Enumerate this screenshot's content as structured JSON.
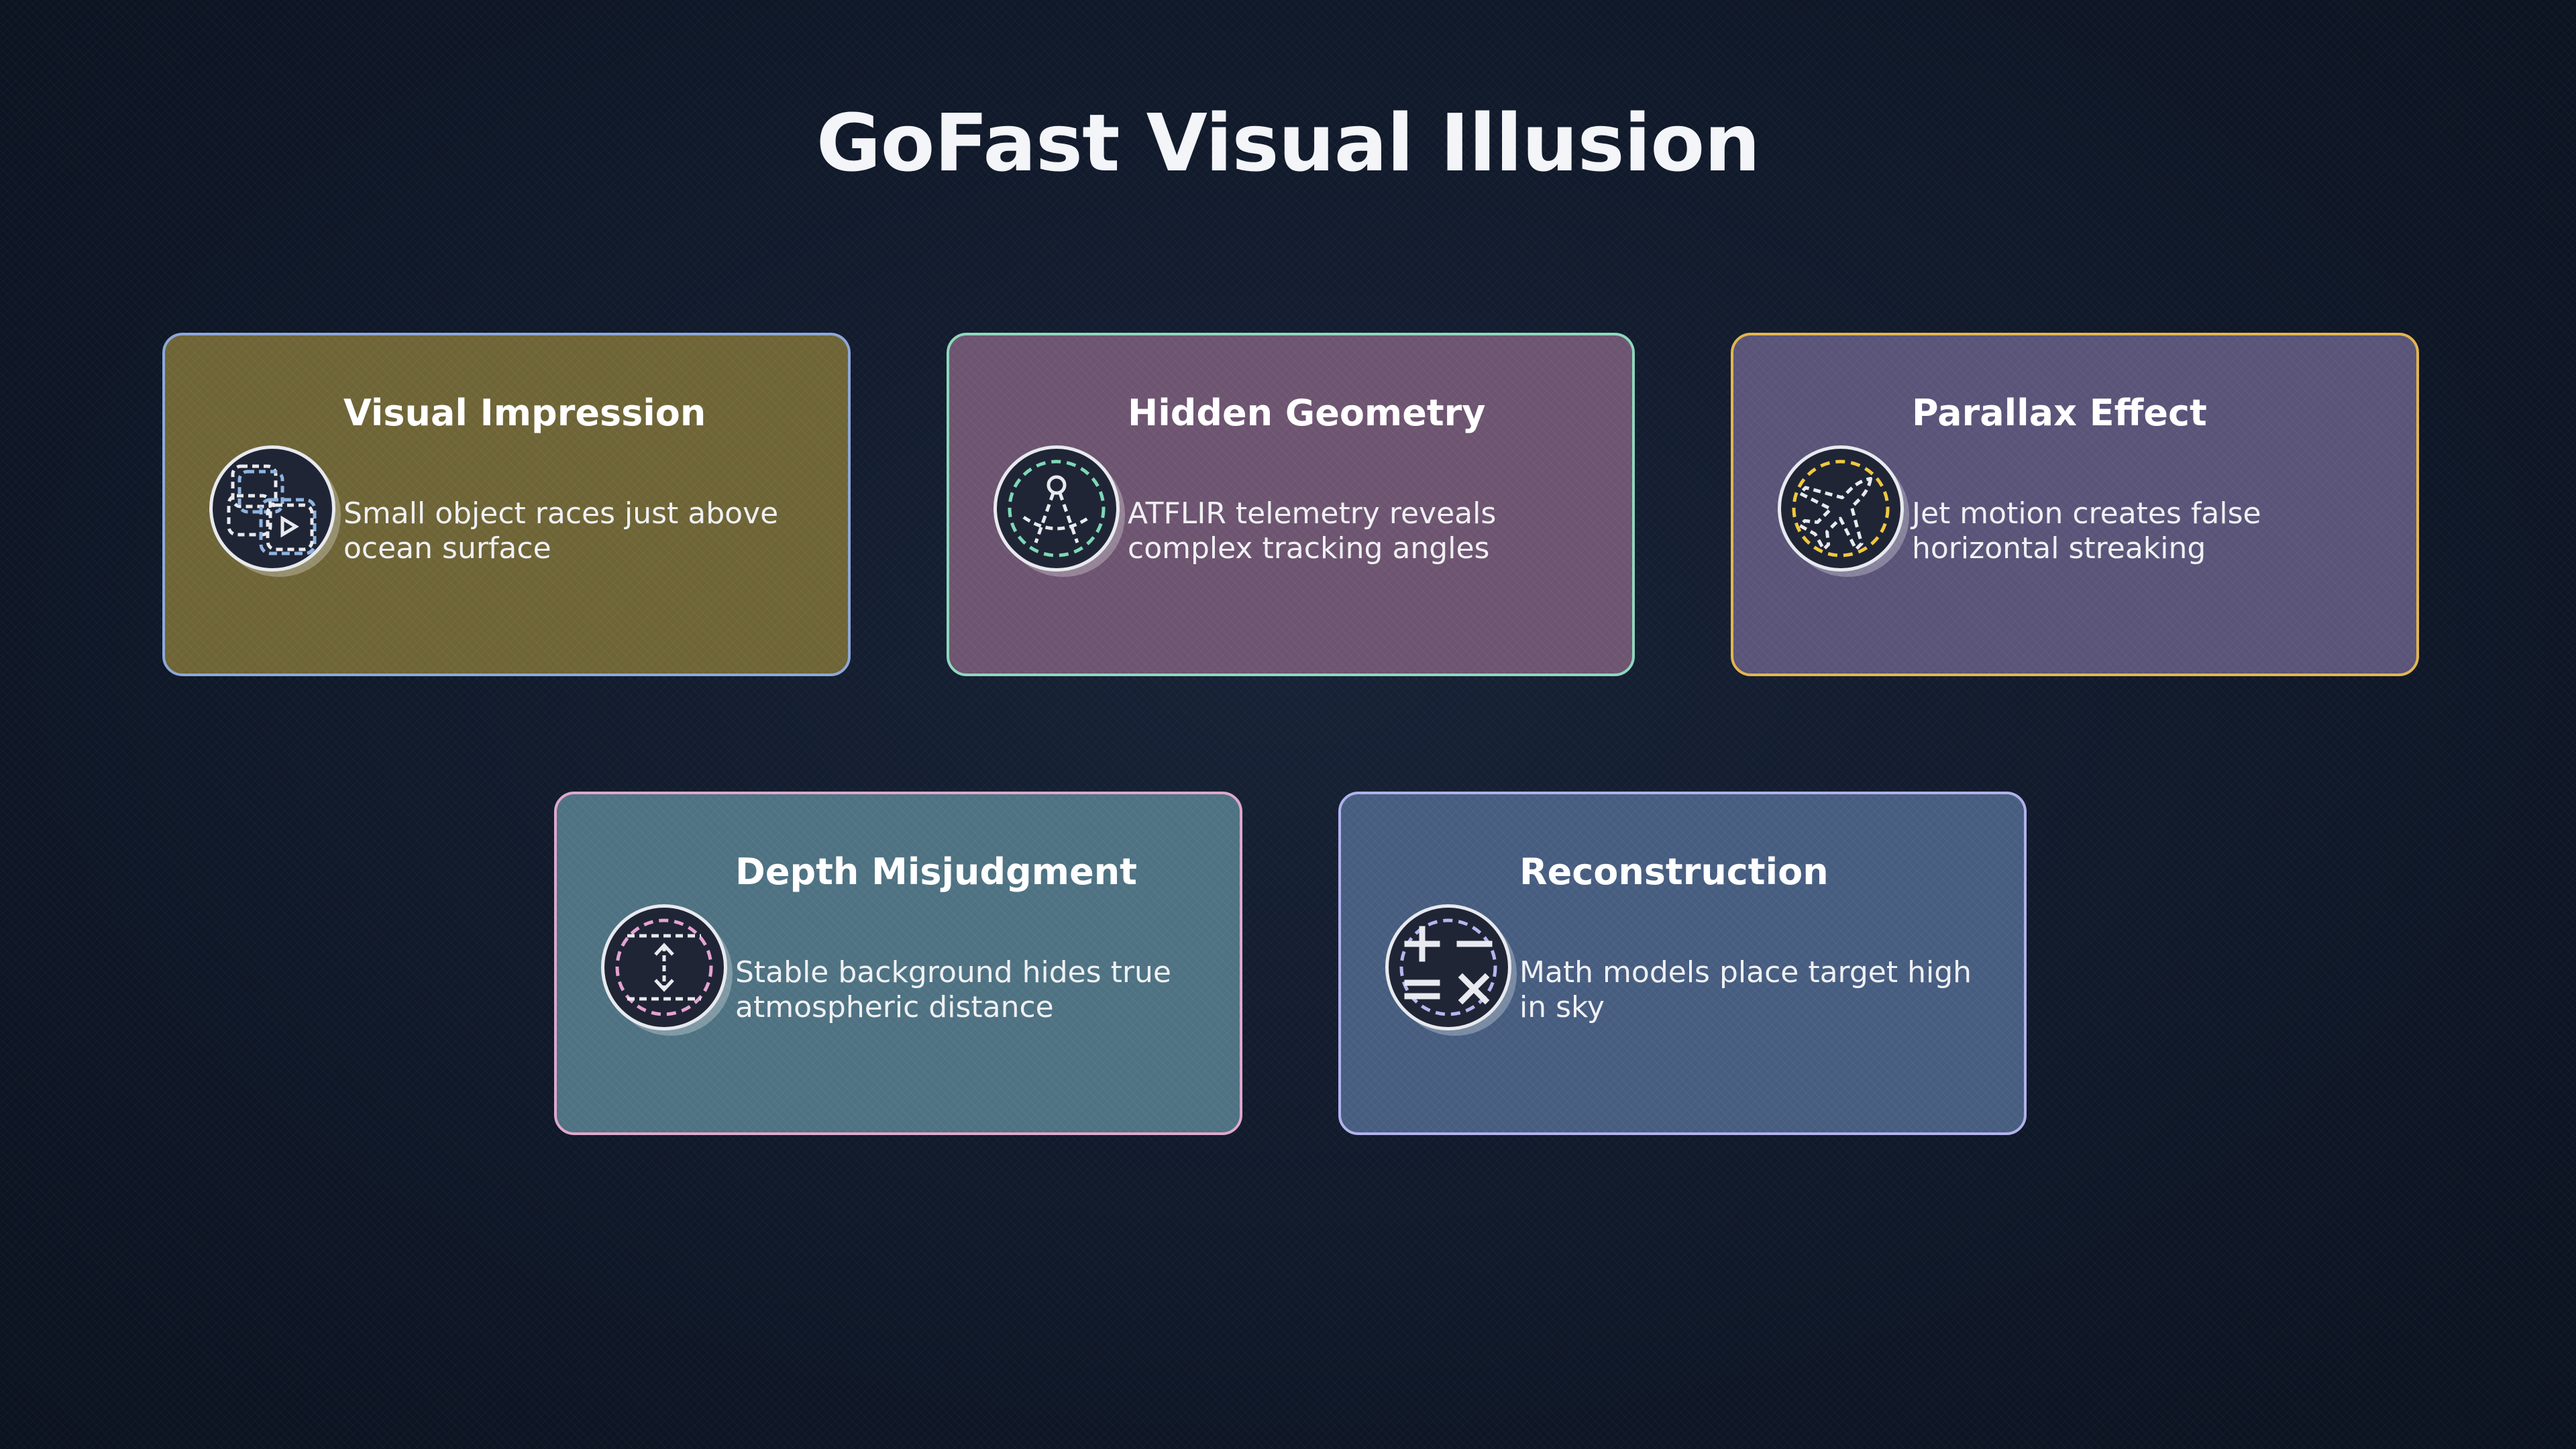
{
  "title": "GoFast Visual Illusion",
  "cards": [
    {
      "title": "Visual Impression",
      "desc": "Small object races just above ocean surface",
      "icon": "video-frames-icon",
      "bg": "#6e6436",
      "border": "#8fa8d8",
      "accent": "#8fb4e0"
    },
    {
      "title": "Hidden Geometry",
      "desc": "ATFLIR telemetry reveals complex tracking angles",
      "icon": "compass-icon",
      "bg": "#6d5470",
      "border": "#8fd9bd",
      "accent": "#7ed8b6"
    },
    {
      "title": "Parallax Effect",
      "desc": "Jet motion creates false horizontal streaking",
      "icon": "jet-icon",
      "bg": "#595478",
      "border": "#e4b64e",
      "accent": "#f0c842"
    },
    {
      "title": "Depth Misjudgment",
      "desc": "Stable background hides true atmospheric distance",
      "icon": "vertical-distance-icon",
      "bg": "#4e7282",
      "border": "#e0a8cc",
      "accent": "#e6a3d2"
    },
    {
      "title": "Reconstruction",
      "desc": "Math models place target high in sky",
      "icon": "math-operators-icon",
      "bg": "#465d80",
      "border": "#b2b2ec",
      "accent": "#b6b6f0"
    }
  ]
}
